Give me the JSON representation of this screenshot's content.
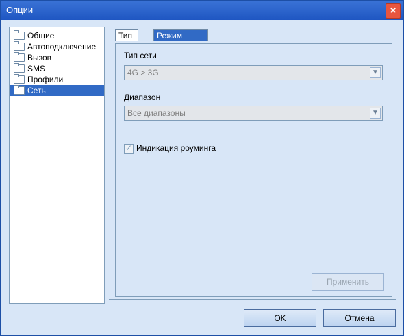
{
  "window": {
    "title": "Опции",
    "close_label": "×"
  },
  "sidebar": {
    "items": [
      {
        "label": "Общие"
      },
      {
        "label": "Автоподключение"
      },
      {
        "label": "Вызов"
      },
      {
        "label": "SMS"
      },
      {
        "label": "Профили"
      },
      {
        "label": "Сеть",
        "selected": true
      }
    ]
  },
  "tabs": [
    {
      "label": "Тип сети",
      "active": true
    },
    {
      "label": "Режим регистрации",
      "active": false
    }
  ],
  "form": {
    "network_type": {
      "label": "Тип сети",
      "value": "4G > 3G"
    },
    "range": {
      "label": "Диапазон",
      "value": "Все диапазоны"
    },
    "roaming_indication": {
      "label": "Индикация роуминга",
      "checked": true
    }
  },
  "buttons": {
    "apply": "Применить",
    "ok": "OK",
    "cancel": "Отмена"
  },
  "colors": {
    "titlebar": "#1f56c2",
    "selection": "#316ac5",
    "close": "#e8553f"
  }
}
